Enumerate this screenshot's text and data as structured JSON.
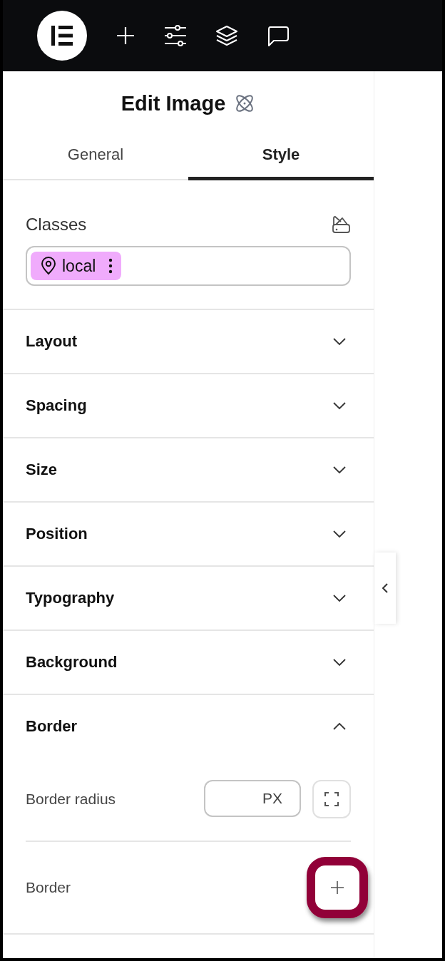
{
  "panel": {
    "title": "Edit Image"
  },
  "tabs": [
    {
      "label": "General",
      "selected": false
    },
    {
      "label": "Style",
      "selected": true
    }
  ],
  "classes": {
    "label": "Classes",
    "chips": [
      {
        "label": "local",
        "color": "#f0abfc"
      }
    ]
  },
  "sections": [
    {
      "label": "Layout",
      "expanded": false
    },
    {
      "label": "Spacing",
      "expanded": false
    },
    {
      "label": "Size",
      "expanded": false
    },
    {
      "label": "Position",
      "expanded": false
    },
    {
      "label": "Typography",
      "expanded": false
    },
    {
      "label": "Background",
      "expanded": false
    },
    {
      "label": "Border",
      "expanded": true,
      "controls": [
        {
          "kind": "unit_field",
          "label": "Border radius",
          "unit": "PX"
        },
        {
          "kind": "add",
          "label": "Border",
          "highlighted": true
        }
      ]
    }
  ]
}
